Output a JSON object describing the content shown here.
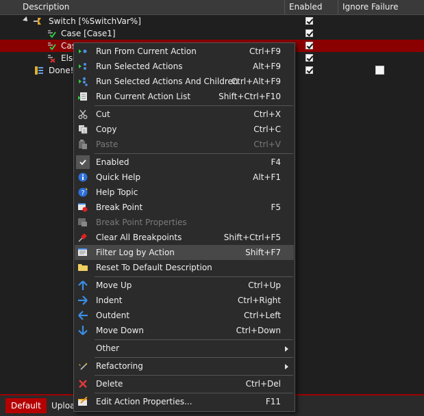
{
  "header": {
    "description": "Description",
    "enabled": "Enabled",
    "ignore_failure": "Ignore Failure"
  },
  "tree": [
    {
      "label": "Switch [%SwitchVar%]",
      "enabled": true,
      "ignore": null,
      "selected": false
    },
    {
      "label": "Case [Case1]",
      "enabled": true,
      "ignore": null,
      "selected": false
    },
    {
      "label": "Cas",
      "enabled": true,
      "ignore": null,
      "selected": true
    },
    {
      "label": "Else",
      "enabled": true,
      "ignore": null,
      "selected": false
    },
    {
      "label": "Done!",
      "enabled": true,
      "ignore": false,
      "selected": false
    }
  ],
  "menu": {
    "items": [
      {
        "label": "Run From Current Action",
        "shortcut": "Ctrl+F9",
        "icon": "run-from-icon"
      },
      {
        "label": "Run Selected Actions",
        "shortcut": "Alt+F9",
        "icon": "run-selected-icon"
      },
      {
        "label": "Run Selected Actions And Children",
        "shortcut": "Ctrl+Alt+F9",
        "icon": "run-children-icon"
      },
      {
        "label": "Run Current Action List",
        "shortcut": "Shift+Ctrl+F10",
        "icon": "run-list-icon"
      },
      {
        "label": "Cut",
        "shortcut": "Ctrl+X",
        "icon": "scissors-icon"
      },
      {
        "label": "Copy",
        "shortcut": "Ctrl+C",
        "icon": "copy-icon"
      },
      {
        "label": "Paste",
        "shortcut": "Ctrl+V",
        "icon": "paste-icon"
      },
      {
        "label": "Enabled",
        "shortcut": "F4",
        "icon": "check-icon"
      },
      {
        "label": "Quick Help",
        "shortcut": "Alt+F1",
        "icon": "info-icon"
      },
      {
        "label": "Help Topic",
        "shortcut": "",
        "icon": "help-icon"
      },
      {
        "label": "Break Point",
        "shortcut": "F5",
        "icon": "breakpoint-icon"
      },
      {
        "label": "Break Point Properties",
        "shortcut": "",
        "icon": "breakpoint-properties-icon"
      },
      {
        "label": "Clear All Breakpoints",
        "shortcut": "Shift+Ctrl+F5",
        "icon": "clear-breakpoints-icon"
      },
      {
        "label": "Filter Log by Action",
        "shortcut": "Shift+F7",
        "icon": "filter-log-icon"
      },
      {
        "label": "Reset To Default Description",
        "shortcut": "",
        "icon": "folder-icon"
      },
      {
        "label": "Move Up",
        "shortcut": "Ctrl+Up",
        "icon": "arrow-up-icon"
      },
      {
        "label": "Indent",
        "shortcut": "Ctrl+Right",
        "icon": "arrow-right-icon"
      },
      {
        "label": "Outdent",
        "shortcut": "Ctrl+Left",
        "icon": "arrow-left-icon"
      },
      {
        "label": "Move Down",
        "shortcut": "Ctrl+Down",
        "icon": "arrow-down-icon"
      },
      {
        "label": "Other",
        "shortcut": "",
        "icon": ""
      },
      {
        "label": "Refactoring",
        "shortcut": "",
        "icon": "refactoring-icon"
      },
      {
        "label": "Delete",
        "shortcut": "Ctrl+Del",
        "icon": "delete-icon"
      },
      {
        "label": "Edit Action Properties...",
        "shortcut": "F11",
        "icon": "edit-properties-icon"
      }
    ]
  },
  "bottom_tabs": [
    "Default",
    "Uploa"
  ],
  "colors": {
    "selection": "#8b0000",
    "accent_red": "#b40000",
    "menu_bg": "#2b2b2b",
    "menu_hover": "#484848"
  }
}
